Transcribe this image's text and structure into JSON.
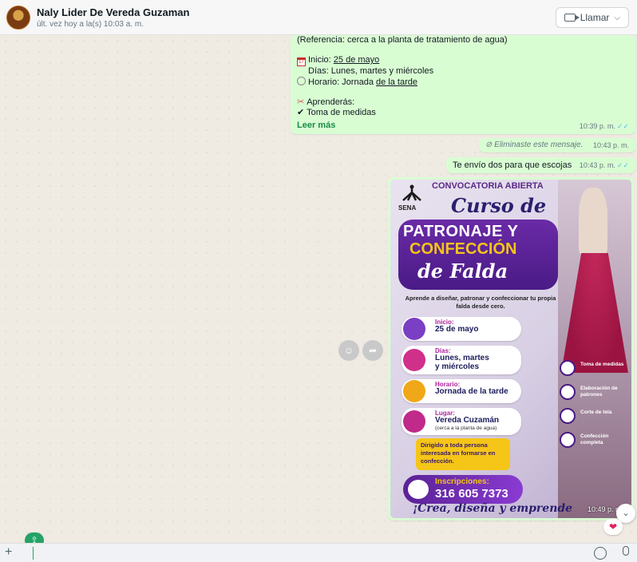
{
  "header": {
    "contact_name": "Naly Lider De Vereda Guzaman",
    "status": "últ. vez hoy a la(s) 10:03 a. m.",
    "call_label": "Llamar",
    "call_chevron": "⌵"
  },
  "messages": {
    "m1": {
      "ref": "(Referencia: cerca a la planta de tratamiento de agua)",
      "inicio_label": "Inicio: ",
      "inicio_value": "25 de mayo",
      "dias": "Días: Lunes, martes y miércoles",
      "horario_label": "Horario: Jornada ",
      "horario_value": "de la tarde",
      "aprenderas": "Aprenderás:",
      "toma": "✔ Toma de medidas",
      "leer_mas": "Leer más",
      "time": "10:39 p. m."
    },
    "m2": {
      "text": "⊘ Eliminaste este mensaje.",
      "time": "10:43 p. m."
    },
    "m3": {
      "text": "Te envío dos para que escojas",
      "time": "10:43 p. m."
    },
    "image": {
      "time": "10:49 p. m.",
      "convocatoria": "CONVOCATORIA ABIERTA",
      "sena": "SENA",
      "curso": "Curso de",
      "patronaje": "PATRONAJE Y",
      "confeccion": "CONFECCIÓN",
      "falda": "de Falda",
      "aprende": "Aprende a diseñar, patronar y confeccionar tu propia falda desde cero.",
      "inicio_k": "Inicio:",
      "inicio_v": "25 de mayo",
      "dias_k": "Días:",
      "dias_v1": "Lunes, martes",
      "dias_v2": "y miércoles",
      "horario_k": "Horario:",
      "horario_v": "Jornada de la tarde",
      "lugar_k": "Lugar:",
      "lugar_v": "Vereda Cuzamán",
      "lugar_sub": "(cerca a la planta de agua)",
      "dirigido": "Dirigido a toda persona interesada en formarse en confección.",
      "insc_k": "Inscripciones:",
      "insc_v": "316 605 7373",
      "crea": "¡Crea, diseña y emprende",
      "t1": "Toma de medidas",
      "t2": "Elaboración de patrones",
      "t3": "Corte de tela",
      "t4": "Confección completa"
    }
  },
  "reaction": "❤",
  "colors": {
    "outgoing_bubble": "#d9fdd3",
    "chat_bg": "#efeae2",
    "read_ticks": "#53bdeb",
    "accent_green": "#25a366"
  }
}
